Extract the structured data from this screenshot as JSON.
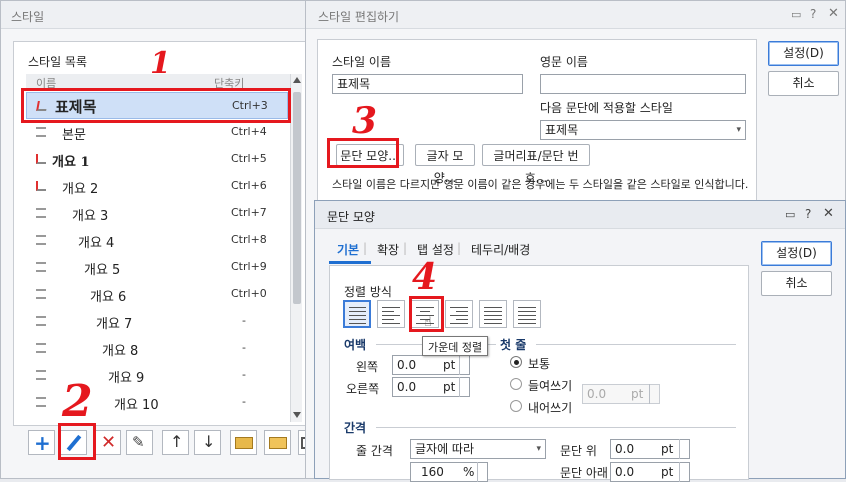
{
  "style_window": {
    "title": "스타일",
    "list_title": "스타일 목록",
    "col_name": "이름",
    "col_shortcut": "단축키",
    "items": [
      {
        "name": "표제목",
        "shortcut": "Ctrl+3"
      },
      {
        "name": "본문",
        "shortcut": "Ctrl+4"
      },
      {
        "name": "개요 1",
        "shortcut": "Ctrl+5"
      },
      {
        "name": "개요 2",
        "shortcut": "Ctrl+6"
      },
      {
        "name": "개요 3",
        "shortcut": "Ctrl+7"
      },
      {
        "name": "개요 4",
        "shortcut": "Ctrl+8"
      },
      {
        "name": "개요 5",
        "shortcut": "Ctrl+9"
      },
      {
        "name": "개요 6",
        "shortcut": "Ctrl+0"
      },
      {
        "name": "개요 7",
        "shortcut": "-"
      },
      {
        "name": "개요 8",
        "shortcut": "-"
      },
      {
        "name": "개요 9",
        "shortcut": "-"
      },
      {
        "name": "개요 10",
        "shortcut": "-"
      }
    ],
    "toolbar_icons": [
      "plus-icon",
      "pencil-icon",
      "delete-x-icon",
      "edit-style-icon",
      "up-arrow-icon",
      "down-arrow-icon",
      "import-folder-icon",
      "open-folder-icon",
      "more-icon"
    ]
  },
  "edit_window": {
    "title": "스타일 편집하기",
    "style_name_label": "스타일 이름",
    "style_name_value": "표제목",
    "english_name_label": "영문 이름",
    "english_name_value": "",
    "next_style_label": "다음 문단에 적용할 스타일",
    "next_style_value": "표제목",
    "para_shape_btn": "문단 모양...",
    "char_shape_btn": "글자 모양...",
    "bullet_btn": "글머리표/문단 번호...",
    "note": "스타일 이름은 다르지만 영문 이름이 같은 경우에는 두 스타일을 같은 스타일로 인식합니다.",
    "ok_btn": "설정(D)",
    "cancel_btn": "취소"
  },
  "para_window": {
    "title": "문단 모양",
    "tabs": [
      "기본",
      "확장",
      "탭 설정",
      "테두리/배경"
    ],
    "align_label": "정렬 방식",
    "tooltip": "가운데 정렬",
    "margin_label": "여백",
    "left_label": "왼쪽",
    "left_value": "0.0",
    "right_label": "오른쪽",
    "right_value": "0.0",
    "unit_pt": "pt",
    "first_line_label": "첫 줄",
    "radio_normal": "보통",
    "radio_indent": "들여쓰기",
    "radio_outdent": "내어쓰기",
    "indent_value": "0.0",
    "spacing_label": "간격",
    "line_spacing_label": "줄 간격",
    "line_spacing_type": "글자에 따라",
    "line_spacing_value": "160",
    "unit_percent": "%",
    "para_above_label": "문단 위",
    "para_above_value": "0.0",
    "para_below_label": "문단 아래",
    "para_below_value": "0.0",
    "ok_btn": "설정(D)",
    "cancel_btn": "취소"
  },
  "annotations": [
    "1",
    "2",
    "3",
    "4"
  ]
}
